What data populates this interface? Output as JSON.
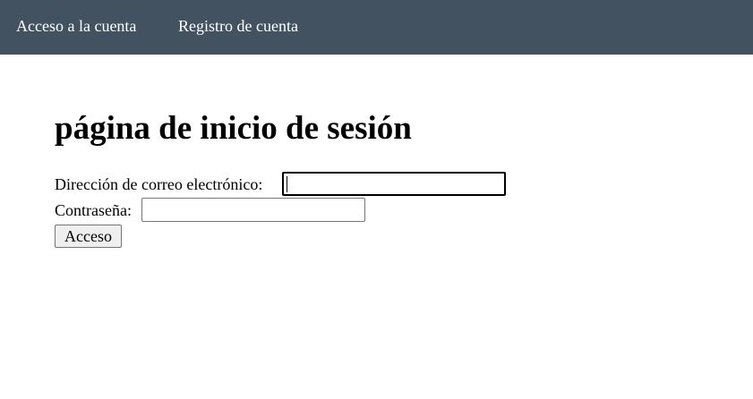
{
  "nav": {
    "login_label": "Acceso a la cuenta",
    "register_label": "Registro de cuenta",
    "background_color": "#435261"
  },
  "main": {
    "title": "página de inicio de sesión",
    "form": {
      "email_label": "Dirección de correo electrónico:",
      "email_value": "",
      "password_label": "Contraseña:",
      "password_value": "",
      "submit_label": "Acceso"
    }
  }
}
